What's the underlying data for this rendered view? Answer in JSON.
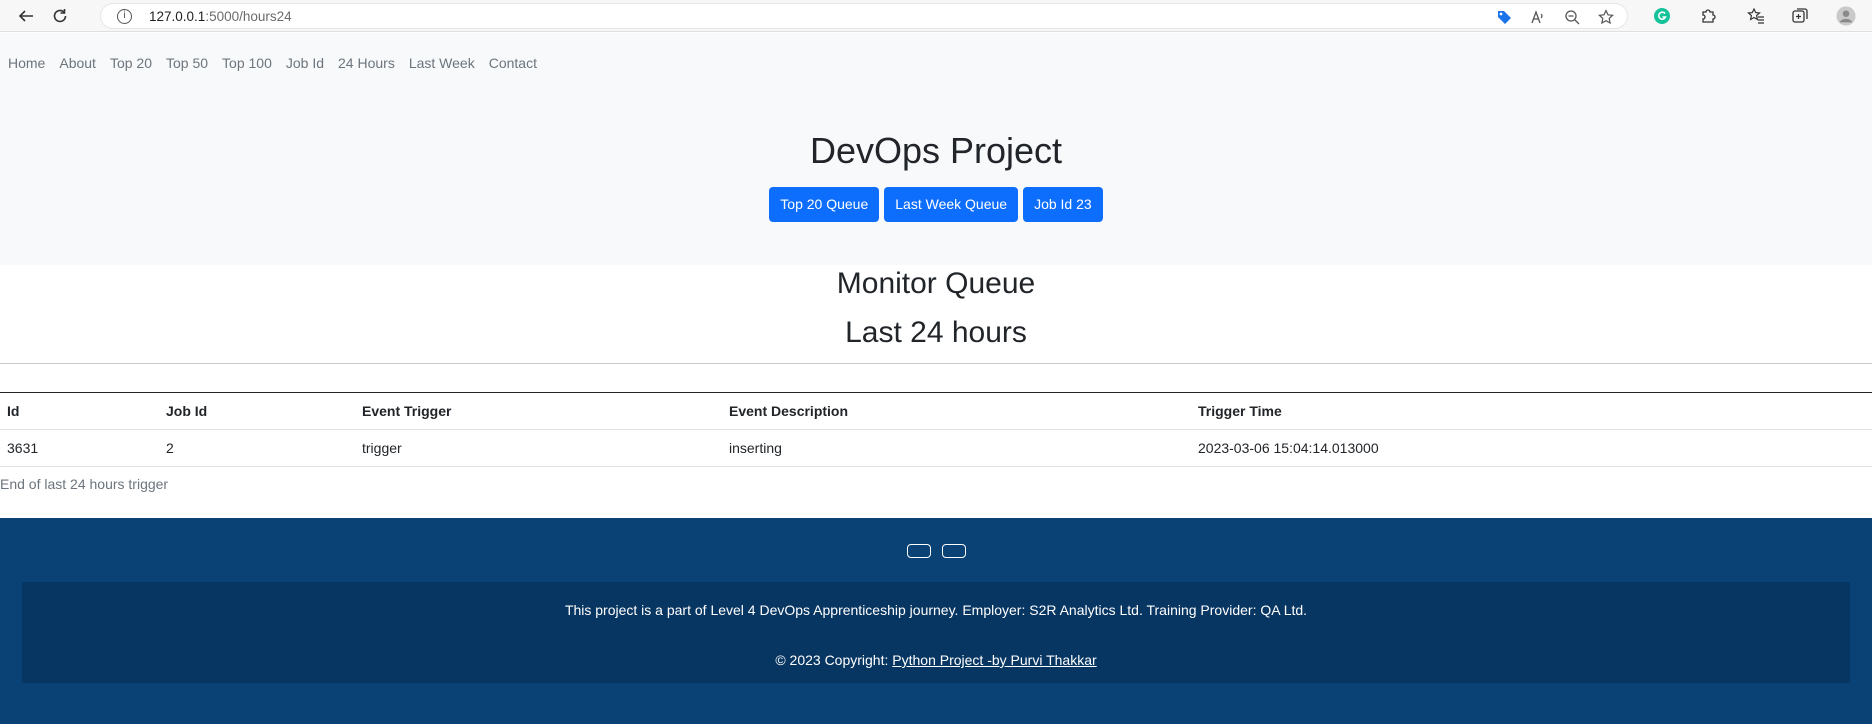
{
  "browser": {
    "url_host": "127.0.0.1",
    "url_path": ":5000/hours24",
    "info_glyph": "i"
  },
  "nav": {
    "items": [
      "Home",
      "About",
      "Top 20",
      "Top 50",
      "Top 100",
      "Job Id",
      "24 Hours",
      "Last Week",
      "Contact"
    ]
  },
  "hero": {
    "title": "DevOps Project",
    "buttons": [
      "Top 20 Queue",
      "Last Week Queue",
      "Job Id 23"
    ]
  },
  "main": {
    "heading": "Monitor Queue",
    "subheading": "Last 24 hours",
    "table": {
      "columns": [
        "Id",
        "Job Id",
        "Event Trigger",
        "Event Description",
        "Trigger Time"
      ],
      "rows": [
        [
          "3631",
          "2",
          "trigger",
          "inserting",
          "2023-03-06 15:04:14.013000"
        ]
      ]
    },
    "end_text": "End of last 24 hours trigger"
  },
  "footer": {
    "line1": "This project is a part of Level 4 DevOps Apprenticeship journey. Employer: S2R Analytics Ltd. Training Provider: QA Ltd.",
    "copyright_prefix": "© 2023 Copyright: ",
    "copyright_link": "Python Project -by Purvi Thakkar"
  },
  "colors": {
    "primary_button": "#0d6efd",
    "footer_bg": "#0b4275",
    "footer_inner_bg": "#083662",
    "hero_bg": "#f8f9fa"
  }
}
